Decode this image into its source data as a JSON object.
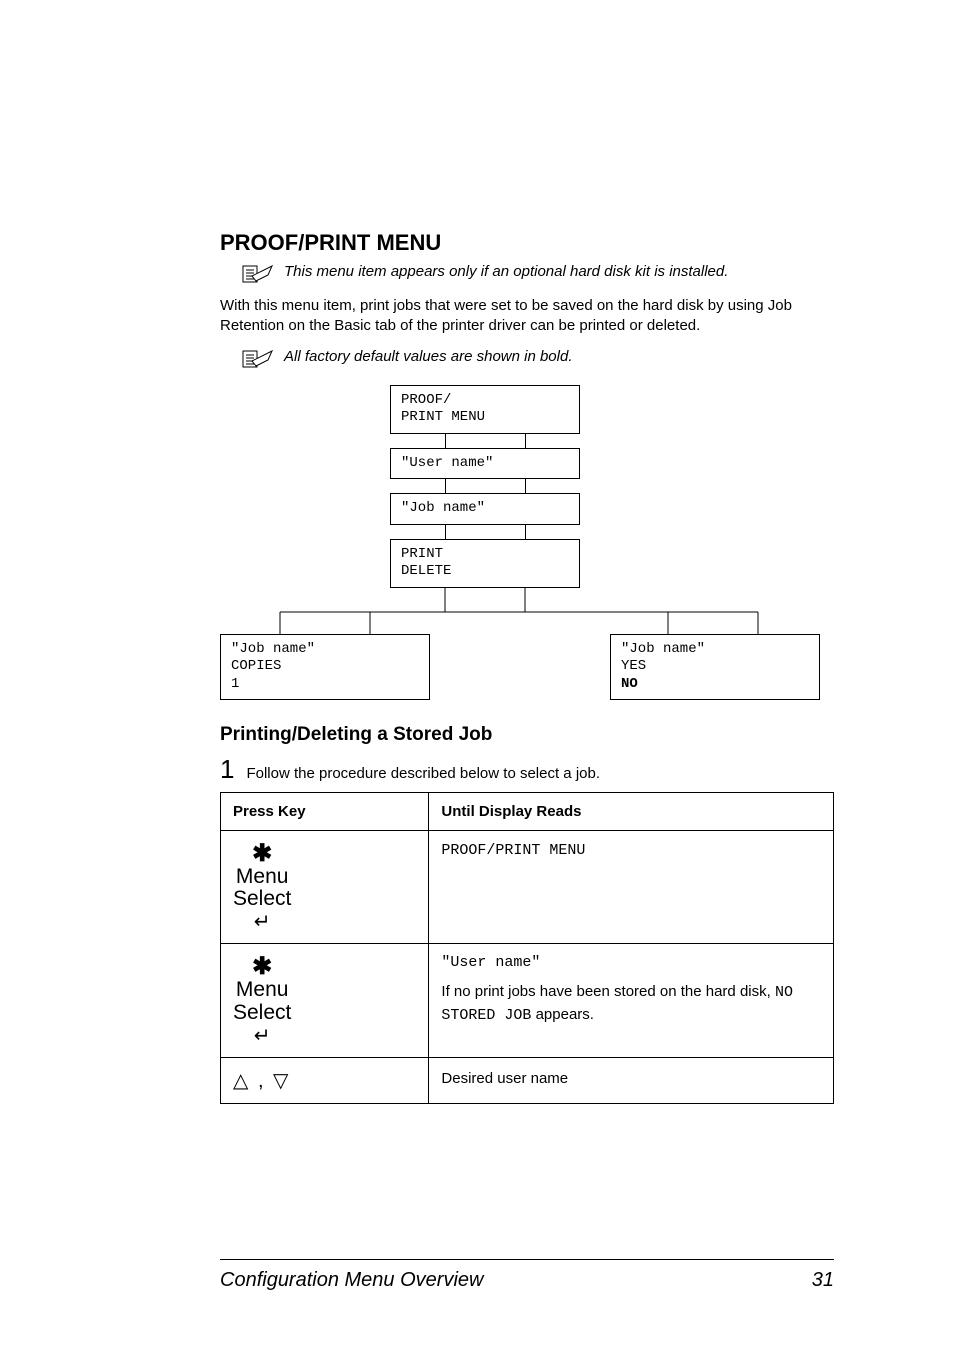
{
  "headings": {
    "main": "PROOF/PRINT MENU",
    "sub": "Printing/Deleting a Stored Job"
  },
  "notes": {
    "note1": "This menu item appears only if an optional hard disk kit is installed.",
    "note2": "All factory default values are shown in bold."
  },
  "body": {
    "p1": "With this menu item, print jobs that were set to be saved on the hard disk by using Job Retention on the Basic tab of the printer driver can be printed or deleted."
  },
  "flow": {
    "root_l1": "PROOF/",
    "root_l2": "PRINT MENU",
    "user": "\"User name\"",
    "job": "\"Job name\"",
    "action_l1": "PRINT",
    "action_l2": "DELETE",
    "left_l1": "\"Job name\"",
    "left_l2": "COPIES",
    "left_l3": "1",
    "right_l1": "\"Job name\"",
    "right_l2": "YES",
    "right_l3": "NO"
  },
  "steps": {
    "n1": "1",
    "t1": "Follow the procedure described below to select a job."
  },
  "menu_button": {
    "line1": "Menu",
    "line2": "Select"
  },
  "table": {
    "h1": "Press Key",
    "h2": "Until Display Reads",
    "r1c2": "PROOF/PRINT MENU",
    "r2c2_mono": "\"User name\"",
    "r2c2_p_a": "If no print jobs have been stored on the hard disk, ",
    "r2c2_p_mono": "NO STORED JOB",
    "r2c2_p_b": " appears.",
    "r3c1": "△ , ▽",
    "r3c2": "Desired user name"
  },
  "footer": {
    "left": "Configuration Menu Overview",
    "right": "31"
  }
}
